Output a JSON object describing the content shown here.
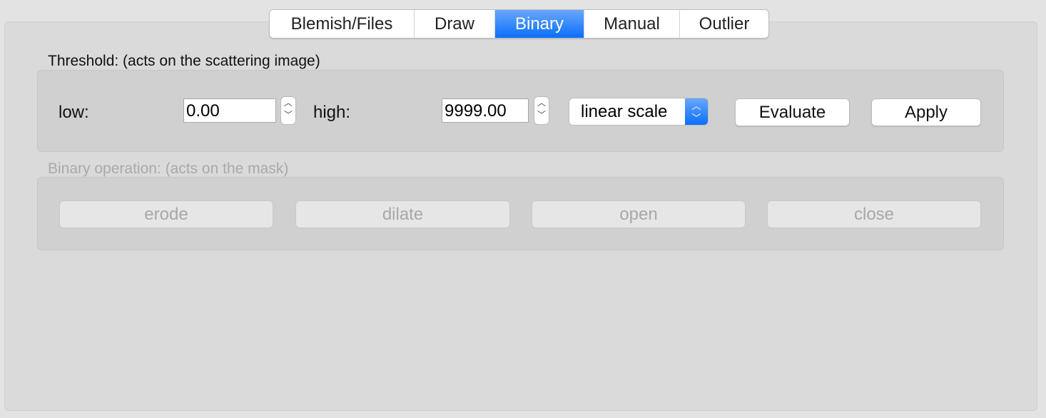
{
  "tabs": [
    {
      "label": "Blemish/Files"
    },
    {
      "label": "Draw"
    },
    {
      "label": "Binary",
      "active": true
    },
    {
      "label": "Manual"
    },
    {
      "label": "Outlier"
    }
  ],
  "threshold": {
    "title": "Threshold: (acts on the scattering image)",
    "low_label": "low:",
    "low_value": "0.00",
    "high_label": "high:",
    "high_value": "9999.00",
    "scale_selected": "linear scale",
    "evaluate_label": "Evaluate",
    "apply_label": "Apply"
  },
  "binary": {
    "title": "Binary operation: (acts on the mask)",
    "enabled": false,
    "buttons": [
      {
        "label": "erode"
      },
      {
        "label": "dilate"
      },
      {
        "label": "open"
      },
      {
        "label": "close"
      }
    ]
  },
  "colors": {
    "accent": "#0a6ffd"
  },
  "icons": {
    "stepper": "up-down-chevron-icon"
  }
}
